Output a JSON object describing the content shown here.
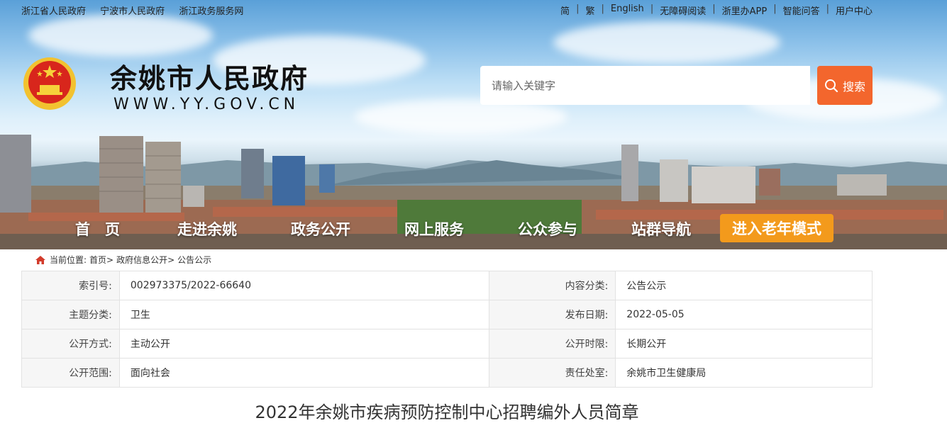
{
  "top_links_left": [
    "浙江省人民政府",
    "宁波市人民政府",
    "浙江政务服务网"
  ],
  "top_links_right": [
    "简",
    "繁",
    "English",
    "无障碍阅读",
    "浙里办APP",
    "智能问答",
    "用户中心"
  ],
  "site": {
    "title": "余姚市人民政府",
    "url": "WWW.YY.GOV.CN"
  },
  "search": {
    "placeholder": "请输入关键字",
    "button_label": "搜索"
  },
  "nav": {
    "items": [
      "首　页",
      "走进余姚",
      "政务公开",
      "网上服务",
      "公众参与",
      "站群导航"
    ],
    "elder_mode": "进入老年模式"
  },
  "breadcrumb": {
    "label": "当前位置:",
    "items": [
      "首页>",
      "政府信息公开>",
      "公告公示"
    ]
  },
  "info": [
    {
      "l1": "索引号:",
      "v1": "002973375/2022-66640",
      "l2": "内容分类:",
      "v2": "公告公示"
    },
    {
      "l1": "主题分类:",
      "v1": "卫生",
      "l2": "发布日期:",
      "v2": "2022-05-05"
    },
    {
      "l1": "公开方式:",
      "v1": "主动公开",
      "l2": "公开时限:",
      "v2": "长期公开"
    },
    {
      "l1": "公开范围:",
      "v1": "面向社会",
      "l2": "责任处室:",
      "v2": "余姚市卫生健康局"
    }
  ],
  "article": {
    "title": "2022年余姚市疾病预防控制中心招聘编外人员简章"
  },
  "colors": {
    "search_button": "#f3662d",
    "elder_mode": "#f39a1c",
    "table_label_bg": "#f6f6f6"
  }
}
